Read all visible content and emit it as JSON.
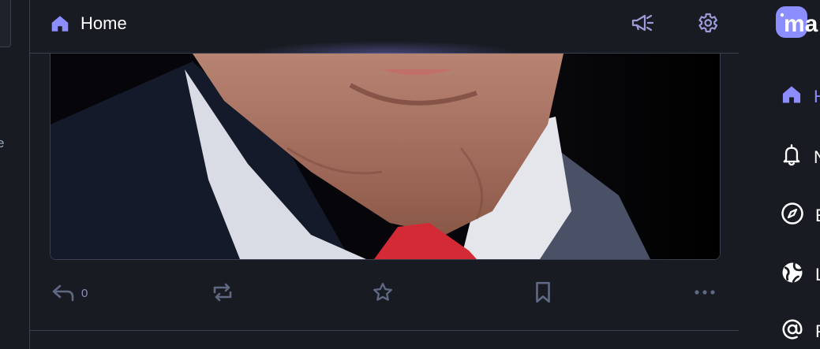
{
  "header": {
    "title": "Home",
    "home_icon": "home-icon",
    "announcements_icon": "megaphone-icon",
    "settings_icon": "gear-icon"
  },
  "post": {
    "media_alt": "",
    "actions": {
      "reply_count": "0",
      "reply_icon": "reply-icon",
      "boost_icon": "boost-icon",
      "favourite_icon": "star-icon",
      "bookmark_icon": "bookmark-icon",
      "more_icon": "more-icon"
    }
  },
  "left_column": {
    "fragment": "e"
  },
  "logo": {
    "text": "ma",
    "icon": "mastodon-logo"
  },
  "navigation": [
    {
      "label": "H",
      "icon": "home-icon",
      "active": true
    },
    {
      "label": "N",
      "icon": "bell-icon",
      "active": false
    },
    {
      "label": "E",
      "icon": "compass-icon",
      "active": false
    },
    {
      "label": "L",
      "icon": "globe-icon",
      "active": false
    },
    {
      "label": "P",
      "icon": "at-icon",
      "active": false
    }
  ],
  "colors": {
    "background": "#191b22",
    "border": "#393f4f",
    "accent": "#8c8dff",
    "icon_muted": "#606984"
  }
}
